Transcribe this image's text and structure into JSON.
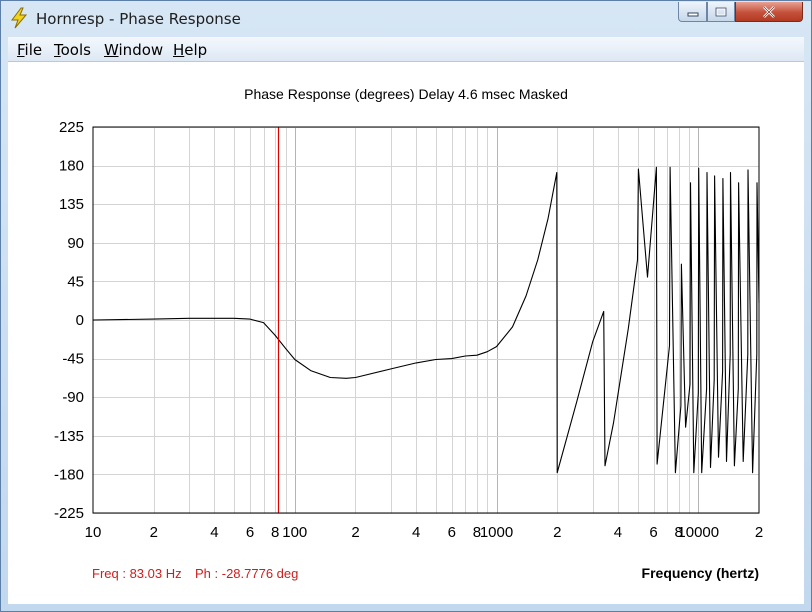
{
  "window": {
    "title": "Hornresp - Phase Response",
    "app_icon": "lightning-bolt-icon",
    "controls": [
      "minimize-icon",
      "maximize-icon",
      "close-icon"
    ]
  },
  "menu": {
    "items": [
      "File",
      "Tools",
      "Window",
      "Help"
    ]
  },
  "readout": {
    "freq": "Freq : 83.03 Hz",
    "phase": "Ph : -28.7776 deg"
  },
  "colors": {
    "cursor": "#e00000",
    "readout": "#cc1e1e",
    "curve": "#000000",
    "grid": "#d4d4d4"
  },
  "chart_data": {
    "type": "line",
    "title": "Phase Response (degrees)   Delay 4.6 msec   Masked",
    "xlabel": "Frequency (hertz)",
    "ylabel": "",
    "x_scale": "log",
    "xlim": [
      10,
      20000
    ],
    "ylim": [
      -225,
      225
    ],
    "y_ticks": [
      225,
      180,
      135,
      90,
      45,
      0,
      -45,
      -90,
      -135,
      -180,
      -225
    ],
    "x_ticks": [
      {
        "value": 10,
        "label": "10"
      },
      {
        "value": 20,
        "label": "2"
      },
      {
        "value": 40,
        "label": "4"
      },
      {
        "value": 60,
        "label": "6"
      },
      {
        "value": 80,
        "label": "8"
      },
      {
        "value": 100,
        "label": "100"
      },
      {
        "value": 200,
        "label": "2"
      },
      {
        "value": 400,
        "label": "4"
      },
      {
        "value": 600,
        "label": "6"
      },
      {
        "value": 800,
        "label": "8"
      },
      {
        "value": 1000,
        "label": "1000"
      },
      {
        "value": 2000,
        "label": "2"
      },
      {
        "value": 4000,
        "label": "4"
      },
      {
        "value": 6000,
        "label": "6"
      },
      {
        "value": 8000,
        "label": "8"
      },
      {
        "value": 10000,
        "label": "10000"
      },
      {
        "value": 20000,
        "label": "2"
      }
    ],
    "cursor_freq": 83.03,
    "grid": true,
    "series": [
      {
        "x": [
          10,
          20,
          30,
          40,
          50,
          60,
          70,
          80,
          90,
          100,
          120,
          150,
          180,
          200,
          300,
          400,
          500,
          600,
          700,
          800,
          900,
          1000,
          1200,
          1400,
          1600,
          1800,
          1990,
          2000,
          2500,
          3000,
          3400,
          3450,
          3800,
          4500,
          5000,
          5050,
          5600,
          6200,
          6250,
          6700,
          7200,
          7250,
          7700,
          8200,
          8250,
          8650,
          9100,
          9150,
          9500,
          10000,
          10050,
          10400,
          11000,
          11050,
          11500,
          12000,
          12050,
          12600,
          13200,
          13250,
          13800,
          14400,
          14450,
          15100,
          15800,
          15850,
          16700,
          17600,
          17650,
          18600,
          19500,
          19550,
          20000
        ],
        "y": [
          0,
          1,
          2,
          2,
          2,
          1,
          -3,
          -18,
          -33,
          -46,
          -59,
          -67,
          -68,
          -67,
          -57,
          -50,
          -46,
          -45,
          -42,
          -41,
          -37,
          -31,
          -8,
          28,
          70,
          118,
          172,
          -178,
          -95,
          -25,
          10,
          -170,
          -120,
          -10,
          70,
          176,
          50,
          178,
          -168,
          -100,
          -30,
          178,
          -178,
          -100,
          65,
          -125,
          -75,
          160,
          -178,
          -85,
          177,
          -178,
          -80,
          172,
          -172,
          -70,
          168,
          -160,
          -60,
          165,
          -165,
          -40,
          172,
          -170,
          -80,
          160,
          -165,
          -40,
          175,
          -178,
          -40,
          160,
          20
        ]
      }
    ]
  }
}
